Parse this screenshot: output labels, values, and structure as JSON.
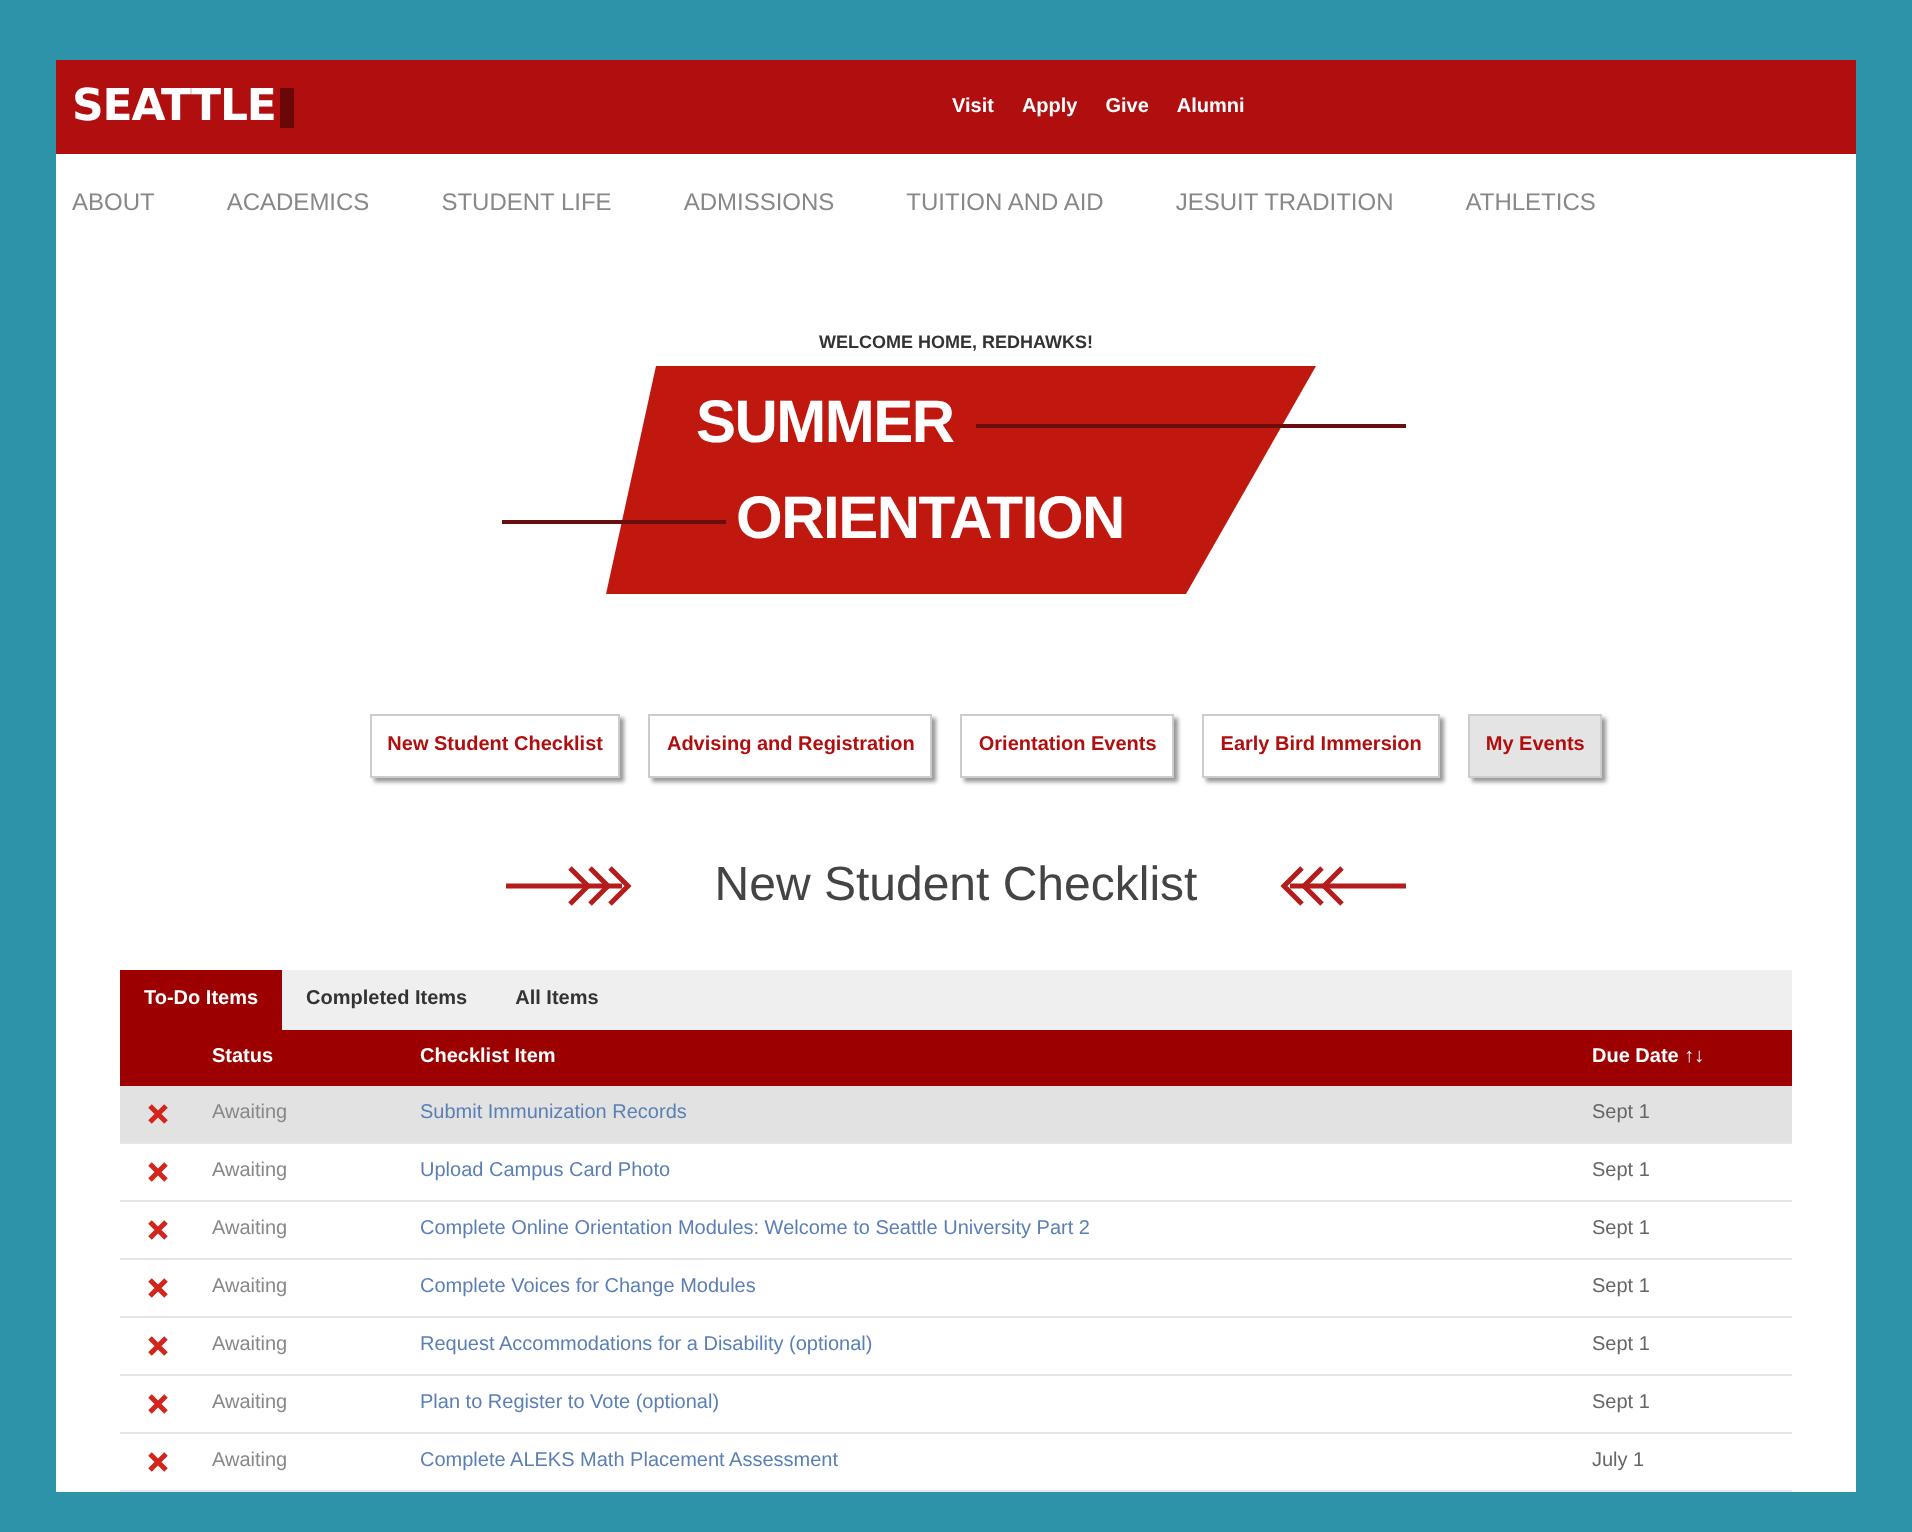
{
  "header": {
    "logo": "SEATTLE",
    "links": [
      "Visit",
      "Apply",
      "Give",
      "Alumni"
    ]
  },
  "nav": [
    "ABOUT",
    "ACADEMICS",
    "STUDENT LIFE",
    "ADMISSIONS",
    "TUITION AND AID",
    "JESUIT TRADITION",
    "ATHLETICS"
  ],
  "banner": {
    "kicker": "WELCOME HOME, REDHAWKS!",
    "line_1": "SUMMER",
    "line_2": "ORIENTATION"
  },
  "section_buttons": [
    {
      "label": "New Student Checklist",
      "selected": false
    },
    {
      "label": "Advising and Registration",
      "selected": false
    },
    {
      "label": "Orientation Events",
      "selected": false
    },
    {
      "label": "Early Bird Immersion",
      "selected": false
    },
    {
      "label": "My Events",
      "selected": true
    }
  ],
  "heading": "New Student Checklist",
  "tabs": [
    {
      "label": "To-Do Items",
      "selected": true
    },
    {
      "label": "Completed Items",
      "selected": false
    },
    {
      "label": "All Items",
      "selected": false
    }
  ],
  "table": {
    "columns": [
      "Status",
      "Checklist Item",
      "Due Date ↑↓"
    ],
    "rows": [
      {
        "status": "Awaiting",
        "item": "Submit Immunization Records",
        "due": "Sept 1",
        "highlighted": true
      },
      {
        "status": "Awaiting",
        "item": "Upload Campus Card Photo",
        "due": "Sept 1",
        "highlighted": false
      },
      {
        "status": "Awaiting",
        "item": "Complete Online Orientation Modules: Welcome to Seattle University Part 2",
        "due": "Sept 1",
        "highlighted": false
      },
      {
        "status": "Awaiting",
        "item": "Complete Voices for Change Modules",
        "due": "Sept 1",
        "highlighted": false
      },
      {
        "status": "Awaiting",
        "item": "Request Accommodations for a Disability (optional)",
        "due": "Sept 1",
        "highlighted": false
      },
      {
        "status": "Awaiting",
        "item": "Plan to Register to Vote (optional)",
        "due": "Sept 1",
        "highlighted": false
      },
      {
        "status": "Awaiting",
        "item": "Complete ALEKS Math Placement Assessment",
        "due": "July 1",
        "highlighted": false
      }
    ]
  }
}
